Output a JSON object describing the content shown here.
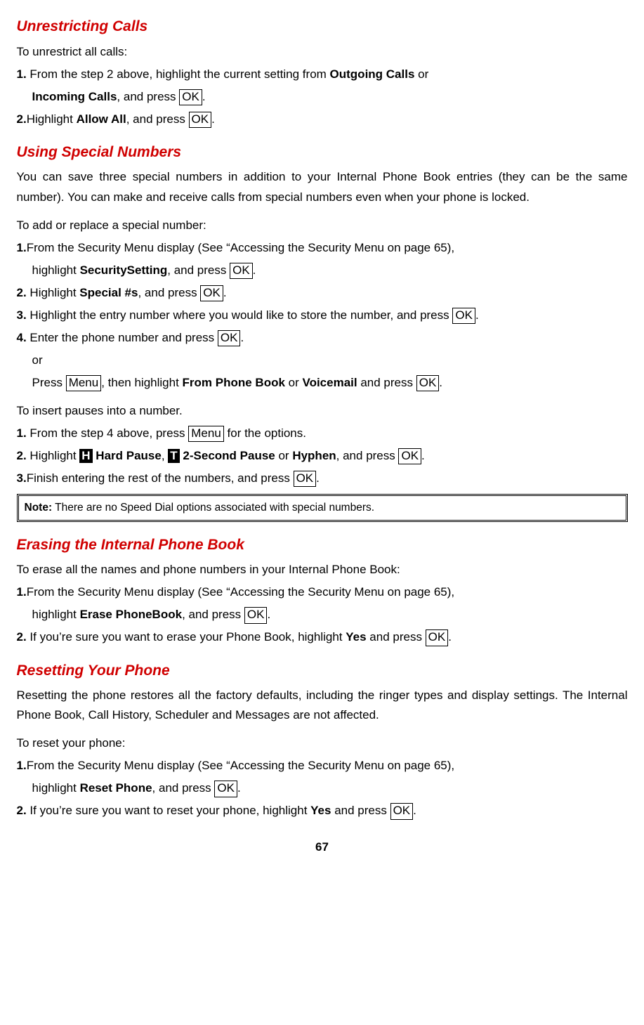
{
  "s1": {
    "heading": "Unrestricting Calls",
    "intro": "To unrestrict all calls:",
    "step1_a": "From the step 2 above, highlight the current setting from ",
    "step1_b": "Outgoing Calls",
    "step1_c": " or",
    "step1_d": "Incoming Calls",
    "step1_e": ", and press ",
    "step2_a": "Highlight ",
    "step2_b": "Allow All",
    "step2_c": ", and press "
  },
  "s2": {
    "heading": "Using Special Numbers",
    "intro": "You can save three special numbers in addition to your Internal Phone Book entries (they can be the same number). You can make and receive calls from special numbers even when your phone is locked.",
    "sub1": "To add or replace a special number:",
    "a1_a": "From the Security Menu display (See “Accessing the Security Menu on page 65),",
    "a1_b": "highlight ",
    "a1_c": "SecuritySetting",
    "a1_d": ", and press ",
    "a2_a": "Highlight ",
    "a2_b": "Special #s",
    "a2_c": ", and press ",
    "a3_a": "Highlight the entry number where you would like to store the number, and press ",
    "a4_a": "Enter the phone number and press ",
    "a4_or": "or",
    "a4_b": "Press ",
    "a4_c": ", then highlight ",
    "a4_d": "From Phone Book",
    "a4_e": " or ",
    "a4_f": "Voicemail",
    "a4_g": " and press ",
    "sub2": "To insert pauses into a number.",
    "b1_a": "From the step 4 above, press ",
    "b1_b": " for the options.",
    "b2_a": "Highlight ",
    "b2_h": "H",
    "b2_b": " Hard Pause",
    "b2_comma": ", ",
    "b2_t": "T",
    "b2_c": " 2-Second Pause",
    "b2_d": " or ",
    "b2_e": "Hyphen",
    "b2_f": ", and press ",
    "b3_a": "Finish entering the rest of the numbers, and press ",
    "note_label": "Note:",
    "note_text": " There are no Speed Dial options associated with special numbers."
  },
  "s3": {
    "heading": "Erasing the Internal Phone Book",
    "intro": "To erase all the names and phone numbers in your Internal Phone Book:",
    "a1_a": "From the Security Menu display (See “Accessing the Security Menu on page 65),",
    "a1_b": "highlight ",
    "a1_c": "Erase PhoneBook",
    "a1_d": ", and press ",
    "a2_a": "If you’re sure you want to erase your Phone Book, highlight ",
    "a2_b": "Yes",
    "a2_c": " and press "
  },
  "s4": {
    "heading": "Resetting Your Phone",
    "intro": "Resetting the phone restores all the factory defaults, including the ringer types and display settings. The Internal Phone Book, Call History, Scheduler and Messages are not affected.",
    "sub": "To reset your phone:",
    "a1_a": "From the Security Menu display (See “Accessing the Security Menu on page 65),",
    "a1_b": "highlight ",
    "a1_c": "Reset Phone",
    "a1_d": ", and press ",
    "a2_a": "If you’re sure you want to reset your phone, highlight ",
    "a2_b": "Yes",
    "a2_c": " and press "
  },
  "keys": {
    "ok": "OK",
    "menu": "Menu"
  },
  "nums": {
    "n1": "1.",
    "n2": "2.",
    "n3": "3.",
    "n4": "4."
  },
  "period": ".",
  "page": "67"
}
